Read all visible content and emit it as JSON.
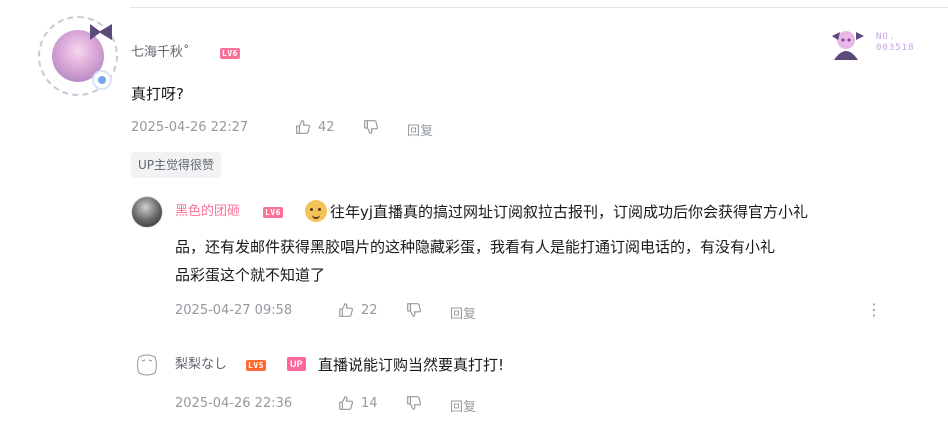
{
  "colors": {
    "username_pink": "#fb7299",
    "username_default": "#61666d",
    "meta_grey": "#9499a0",
    "lv6_red": "#fb7299",
    "lv5_orange": "#ff6a33",
    "up_pink": "#ff6699",
    "tag_bg": "#f1f2f3"
  },
  "main_comment": {
    "username": "七海千秋˚",
    "level": "LV6",
    "text": "真打呀?",
    "date": "2025-04-26 22:27",
    "likes": "42",
    "reply_label": "回复",
    "up_tag": "UP主觉得很赞",
    "fan_card_no": "NO.\n003518"
  },
  "replies": [
    {
      "username": "黑色的团砸",
      "level": "LV6",
      "text_lines": [
        "往年yj直播真的搞过网址订阅叙拉古报刊，订阅成功后你会获得官方小礼",
        "品，还有发邮件获得黑胶唱片的这种隐藏彩蛋，我看有人是能打通订阅电话的，有没有小礼",
        "品彩蛋这个就不知道了"
      ],
      "date": "2025-04-27 09:58",
      "likes": "22",
      "reply_label": "回复"
    },
    {
      "username": "梨梨なし",
      "level": "LV5",
      "up_badge": "UP",
      "text": "直播说能订购当然要真打打!",
      "date": "2025-04-26 22:36",
      "likes": "14",
      "reply_label": "回复"
    }
  ]
}
